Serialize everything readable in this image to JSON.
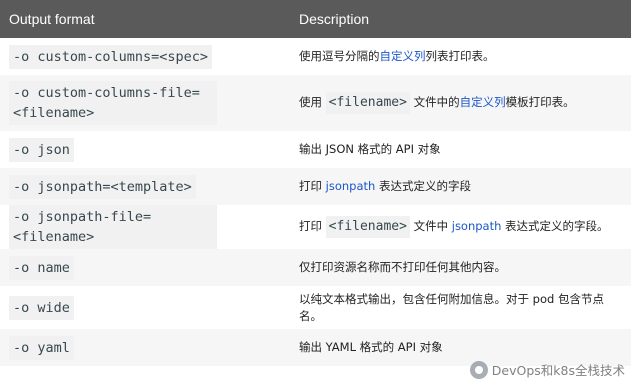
{
  "header": {
    "col1": "Output format",
    "col2": "Description"
  },
  "rows": [
    {
      "option": "-o custom-columns=<spec>",
      "desc": [
        {
          "t": "使用逗号分隔的"
        },
        {
          "t": "自定义列",
          "link": true
        },
        {
          "t": "列表打印表。"
        }
      ]
    },
    {
      "option": "-o custom-columns-file=<filename>",
      "desc": [
        {
          "t": "使用 "
        },
        {
          "t": "<filename>",
          "code": true
        },
        {
          "t": " 文件中的"
        },
        {
          "t": "自定义列",
          "link": true
        },
        {
          "t": "模板打印表。"
        }
      ]
    },
    {
      "option": "-o json",
      "desc": [
        {
          "t": "输出 JSON 格式的 API 对象"
        }
      ]
    },
    {
      "option": "-o jsonpath=<template>",
      "desc": [
        {
          "t": "打印 "
        },
        {
          "t": "jsonpath",
          "link": true
        },
        {
          "t": " 表达式定义的字段"
        }
      ]
    },
    {
      "option": "-o jsonpath-file=<filename>",
      "desc": [
        {
          "t": "打印 "
        },
        {
          "t": "<filename>",
          "code": true
        },
        {
          "t": " 文件中 "
        },
        {
          "t": "jsonpath",
          "link": true
        },
        {
          "t": " 表达式定义的字段。"
        }
      ]
    },
    {
      "option": "-o name",
      "desc": [
        {
          "t": "仅打印资源名称而不打印任何其他内容。"
        }
      ]
    },
    {
      "option": "-o wide",
      "desc": [
        {
          "t": "以纯文本格式输出，包含任何附加信息。对于 pod 包含节点名。"
        }
      ]
    },
    {
      "option": "-o yaml",
      "desc": [
        {
          "t": "输出 YAML 格式的 API 对象"
        }
      ]
    }
  ],
  "watermark": {
    "text": "DevOps和k8s全栈技术",
    "icon": "wechat-icon"
  }
}
